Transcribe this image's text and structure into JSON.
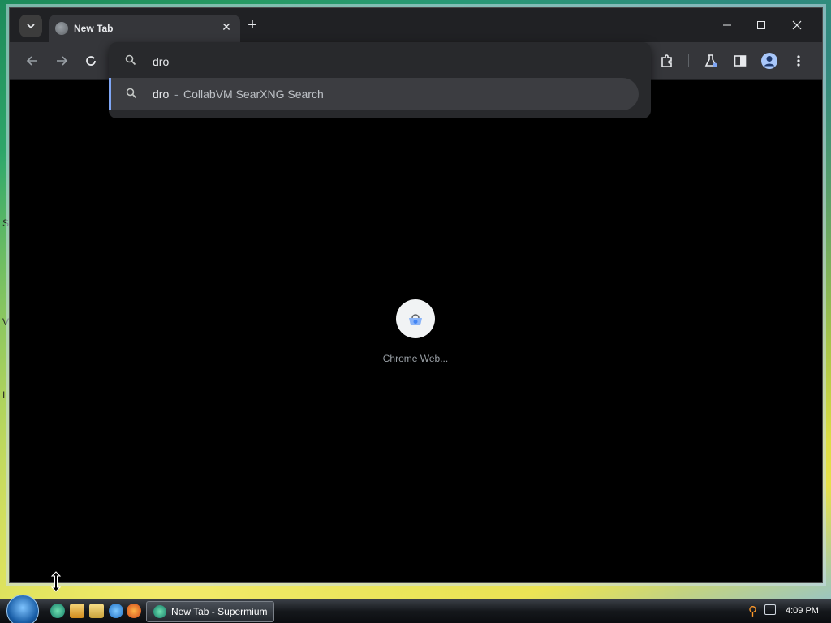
{
  "browser": {
    "tab": {
      "title": "New Tab",
      "close_glyph": "✕"
    },
    "new_tab_glyph": "+",
    "window_controls": {
      "minimize": "—",
      "maximize": "☐",
      "close": "✕"
    }
  },
  "omnibox": {
    "value": "dro",
    "suggestion": {
      "query": "dro",
      "separator": "-",
      "engine": "CollabVM SearXNG Search"
    }
  },
  "content": {
    "shortcut": {
      "label": "Chrome Web..."
    }
  },
  "taskbar": {
    "task_label": "New Tab - Supermium",
    "clock": "4:09 PM"
  },
  "colors": {
    "accent": "#7fa6f5",
    "frame": "#202124",
    "toolbar": "#35363a",
    "content": "#000000"
  },
  "icons": [
    "tab-search-icon",
    "globe-icon",
    "close-icon",
    "plus-icon",
    "back-icon",
    "forward-icon",
    "reload-icon",
    "search-icon",
    "extensions-icon",
    "labs-icon",
    "side-panel-icon",
    "profile-icon",
    "more-menu-icon",
    "chrome-web-store-icon",
    "resize-cursor-icon",
    "start-orb-icon",
    "clock"
  ]
}
